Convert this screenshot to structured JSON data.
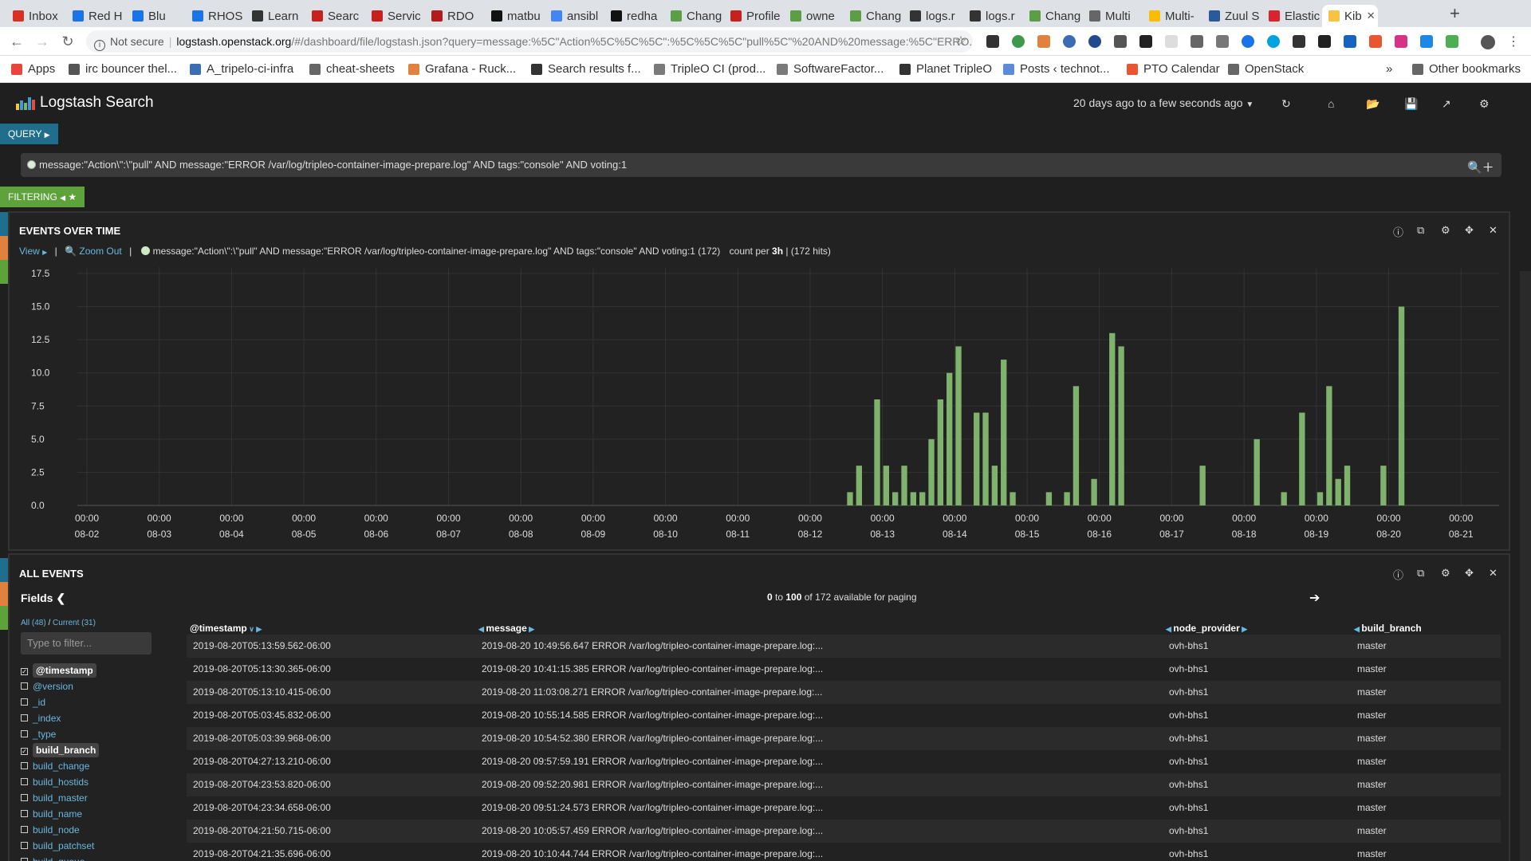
{
  "browser": {
    "tabs": [
      "Inbox",
      "Red H",
      "Blu",
      "RHOS",
      "Learn",
      "Searc",
      "Servic",
      "RDO",
      "matbu",
      "ansibl",
      "redha",
      "Chang",
      "Profile",
      "owne",
      "Chang",
      "logs.r",
      "logs.r",
      "Chang",
      "Multi",
      "Multi-",
      "Zuul S",
      "Elastic",
      "Kib"
    ],
    "tab_colors": [
      "#d93025",
      "#1a73e8",
      "#1a73e8",
      "#1a73e8",
      "#333333",
      "#c5221f",
      "#c5221f",
      "#b31b1b",
      "#111111",
      "#4285f4",
      "#111111",
      "#5b9e45",
      "#c5221f",
      "#5b9e45",
      "#5b9e45",
      "#333333",
      "#333333",
      "#5b9e45",
      "#666666",
      "#fbbc04",
      "#2a5a9a",
      "#d9232e",
      "#f6c342"
    ],
    "new_tab": "+",
    "url_not_secure": "Not secure",
    "url_host": "logstash.openstack.org",
    "url_path": "/#/dashboard/file/logstash.json?query=message:%5C\"Action%5C%5C%5C\":%5C%5C%5C\"pull%5C\"%20AND%20message:%5C\"ERRO...",
    "bookmarks": [
      "Apps",
      "irc bouncer thel...",
      "A_tripelo-ci-infra",
      "cheat-sheets",
      "Grafana - Ruck...",
      "Search results f...",
      "TripleO CI (prod...",
      "SoftwareFactor...",
      "Planet TripleO",
      "Posts ‹ technot...",
      "PTO Calendar",
      "OpenStack"
    ],
    "bookmarks_more": "»",
    "other_bookmarks": "Other bookmarks"
  },
  "app": {
    "title": "Logstash Search",
    "time_range": "20 days ago to a few seconds ago",
    "query_label": "QUERY",
    "query": "message:\"Action\\\":\\\"pull\" AND message:\"ERROR /var/log/tripleo-container-image-prepare.log\" AND tags:\"console\" AND voting:1",
    "filtering_label": "FILTERING"
  },
  "events_panel": {
    "title": "EVENTS OVER TIME",
    "view": "View",
    "zoom_out": "Zoom Out",
    "series_text": "message:\"Action\\\":\\\"pull\" AND message:\"ERROR /var/log/tripleo-container-image-prepare.log\" AND tags:\"console\" AND voting:1 (172)",
    "count_per_prefix": "count per",
    "interval": "3h",
    "hits_text": "(172 hits)"
  },
  "chart_data": {
    "type": "bar",
    "ylim": [
      0,
      17.5
    ],
    "yticks": [
      "0.0",
      "2.5",
      "5.0",
      "7.5",
      "10.0",
      "12.5",
      "15.0",
      "17.5"
    ],
    "xticks": [
      {
        "time": "00:00",
        "date": "08-02"
      },
      {
        "time": "00:00",
        "date": "08-03"
      },
      {
        "time": "00:00",
        "date": "08-04"
      },
      {
        "time": "00:00",
        "date": "08-05"
      },
      {
        "time": "00:00",
        "date": "08-06"
      },
      {
        "time": "00:00",
        "date": "08-07"
      },
      {
        "time": "00:00",
        "date": "08-08"
      },
      {
        "time": "00:00",
        "date": "08-09"
      },
      {
        "time": "00:00",
        "date": "08-10"
      },
      {
        "time": "00:00",
        "date": "08-11"
      },
      {
        "time": "00:00",
        "date": "08-12"
      },
      {
        "time": "00:00",
        "date": "08-13"
      },
      {
        "time": "00:00",
        "date": "08-14"
      },
      {
        "time": "00:00",
        "date": "08-15"
      },
      {
        "time": "00:00",
        "date": "08-16"
      },
      {
        "time": "00:00",
        "date": "08-17"
      },
      {
        "time": "00:00",
        "date": "08-18"
      },
      {
        "time": "00:00",
        "date": "08-19"
      },
      {
        "time": "00:00",
        "date": "08-20"
      },
      {
        "time": "00:00",
        "date": "08-21"
      }
    ],
    "x_start": "2019-08-02T00:00",
    "bin_hours": 3,
    "bars": [
      {
        "t": "2019-08-12T12:00",
        "v": 1
      },
      {
        "t": "2019-08-12T15:00",
        "v": 3
      },
      {
        "t": "2019-08-12T21:00",
        "v": 8
      },
      {
        "t": "2019-08-13T00:00",
        "v": 3
      },
      {
        "t": "2019-08-13T03:00",
        "v": 1
      },
      {
        "t": "2019-08-13T06:00",
        "v": 3
      },
      {
        "t": "2019-08-13T09:00",
        "v": 1
      },
      {
        "t": "2019-08-13T12:00",
        "v": 1
      },
      {
        "t": "2019-08-13T15:00",
        "v": 5
      },
      {
        "t": "2019-08-13T18:00",
        "v": 8
      },
      {
        "t": "2019-08-13T21:00",
        "v": 10
      },
      {
        "t": "2019-08-14T00:00",
        "v": 12
      },
      {
        "t": "2019-08-14T06:00",
        "v": 7
      },
      {
        "t": "2019-08-14T09:00",
        "v": 7
      },
      {
        "t": "2019-08-14T12:00",
        "v": 3
      },
      {
        "t": "2019-08-14T15:00",
        "v": 11
      },
      {
        "t": "2019-08-14T18:00",
        "v": 1
      },
      {
        "t": "2019-08-15T06:00",
        "v": 1
      },
      {
        "t": "2019-08-15T12:00",
        "v": 1
      },
      {
        "t": "2019-08-15T15:00",
        "v": 9
      },
      {
        "t": "2019-08-15T21:00",
        "v": 2
      },
      {
        "t": "2019-08-16T03:00",
        "v": 13
      },
      {
        "t": "2019-08-16T06:00",
        "v": 12
      },
      {
        "t": "2019-08-17T09:00",
        "v": 3
      },
      {
        "t": "2019-08-18T03:00",
        "v": 5
      },
      {
        "t": "2019-08-18T12:00",
        "v": 1
      },
      {
        "t": "2019-08-18T18:00",
        "v": 7
      },
      {
        "t": "2019-08-19T00:00",
        "v": 1
      },
      {
        "t": "2019-08-19T03:00",
        "v": 9
      },
      {
        "t": "2019-08-19T06:00",
        "v": 2
      },
      {
        "t": "2019-08-19T09:00",
        "v": 3
      },
      {
        "t": "2019-08-19T21:00",
        "v": 3
      },
      {
        "t": "2019-08-20T03:00",
        "v": 15
      }
    ],
    "bar_color": "#7eb26d",
    "grid": true
  },
  "all_events": {
    "title": "ALL EVENTS",
    "fields_label": "Fields",
    "all_count": "All (48)",
    "current_count": "Current (31)",
    "filter_placeholder": "Type to filter...",
    "fields": [
      {
        "name": "@timestamp",
        "checked": true
      },
      {
        "name": "@version",
        "checked": false
      },
      {
        "name": "_id",
        "checked": false
      },
      {
        "name": "_index",
        "checked": false
      },
      {
        "name": "_type",
        "checked": false
      },
      {
        "name": "build_branch",
        "checked": true
      },
      {
        "name": "build_change",
        "checked": false
      },
      {
        "name": "build_hostids",
        "checked": false
      },
      {
        "name": "build_master",
        "checked": false
      },
      {
        "name": "build_name",
        "checked": false
      },
      {
        "name": "build_node",
        "checked": false
      },
      {
        "name": "build_patchset",
        "checked": false
      },
      {
        "name": "build_queue",
        "checked": false
      }
    ],
    "paging_from": "0",
    "paging_to": "100",
    "paging_total": "of 172 available for paging",
    "columns": [
      "@timestamp",
      "message",
      "node_provider",
      "build_branch"
    ],
    "rows": [
      [
        "2019-08-20T05:13:59.562-06:00",
        "2019-08-20 10:49:56.647 ERROR /var/log/tripleo-container-image-prepare.log:...",
        "ovh-bhs1",
        "master"
      ],
      [
        "2019-08-20T05:13:30.365-06:00",
        "2019-08-20 10:41:15.385 ERROR /var/log/tripleo-container-image-prepare.log:...",
        "ovh-bhs1",
        "master"
      ],
      [
        "2019-08-20T05:13:10.415-06:00",
        "2019-08-20 11:03:08.271 ERROR /var/log/tripleo-container-image-prepare.log:...",
        "ovh-bhs1",
        "master"
      ],
      [
        "2019-08-20T05:03:45.832-06:00",
        "2019-08-20 10:55:14.585 ERROR /var/log/tripleo-container-image-prepare.log:...",
        "ovh-bhs1",
        "master"
      ],
      [
        "2019-08-20T05:03:39.968-06:00",
        "2019-08-20 10:54:52.380 ERROR /var/log/tripleo-container-image-prepare.log:...",
        "ovh-bhs1",
        "master"
      ],
      [
        "2019-08-20T04:27:13.210-06:00",
        "2019-08-20 09:57:59.191 ERROR /var/log/tripleo-container-image-prepare.log:...",
        "ovh-bhs1",
        "master"
      ],
      [
        "2019-08-20T04:23:53.820-06:00",
        "2019-08-20 09:52:20.981 ERROR /var/log/tripleo-container-image-prepare.log:...",
        "ovh-bhs1",
        "master"
      ],
      [
        "2019-08-20T04:23:34.658-06:00",
        "2019-08-20 09:51:24.573 ERROR /var/log/tripleo-container-image-prepare.log:...",
        "ovh-bhs1",
        "master"
      ],
      [
        "2019-08-20T04:21:50.715-06:00",
        "2019-08-20 10:05:57.459 ERROR /var/log/tripleo-container-image-prepare.log:...",
        "ovh-bhs1",
        "master"
      ],
      [
        "2019-08-20T04:21:35.696-06:00",
        "2019-08-20 10:10:44.744 ERROR /var/log/tripleo-container-image-prepare.log:...",
        "ovh-bhs1",
        "master"
      ]
    ]
  }
}
